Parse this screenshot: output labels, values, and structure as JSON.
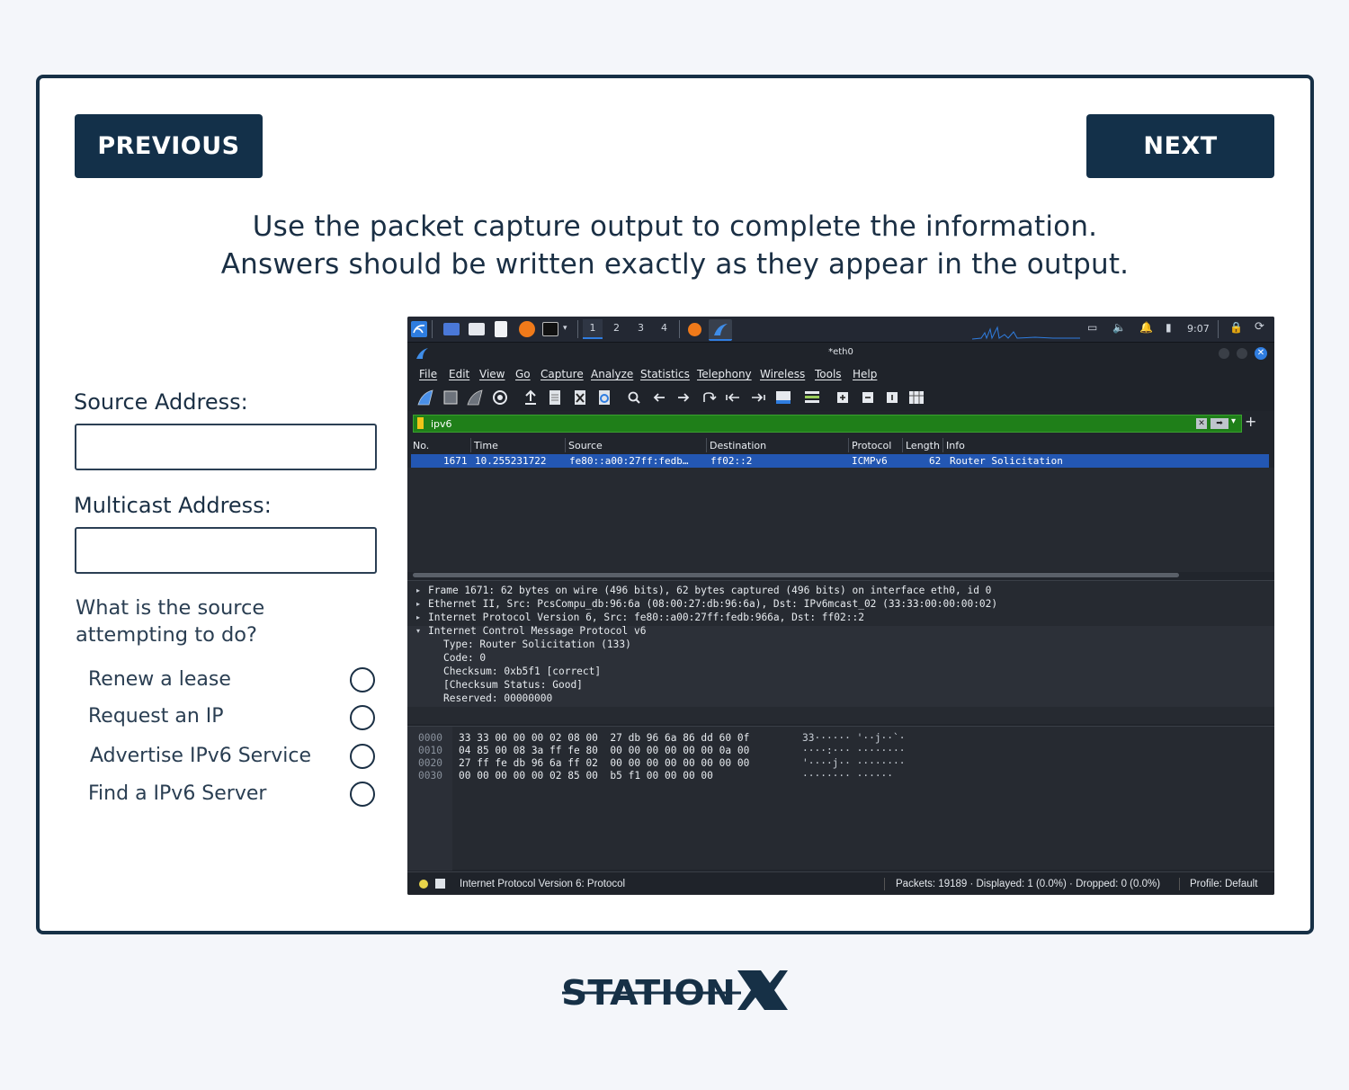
{
  "nav": {
    "previous_label": "PREVIOUS",
    "next_label": "NEXT"
  },
  "instructions": {
    "line1": "Use the packet capture output to complete the information.",
    "line2": "Answers should be written exactly as they appear in the output."
  },
  "form": {
    "source_label": "Source Address:",
    "source_value": "",
    "multicast_label": "Multicast Address:",
    "multicast_value": "",
    "question": "What is the source attempting to do?",
    "options": [
      "Renew a lease",
      "Request an IP",
      "Advertise IPv6 Service",
      "Find a IPv6 Server"
    ]
  },
  "wireshark": {
    "taskbar": {
      "workspaces": [
        "1",
        "2",
        "3",
        "4"
      ],
      "clock": "9:07"
    },
    "window_title": "*eth0",
    "menu": [
      "File",
      "Edit",
      "View",
      "Go",
      "Capture",
      "Analyze",
      "Statistics",
      "Telephony",
      "Wireless",
      "Tools",
      "Help"
    ],
    "filter": "ipv6",
    "columns": [
      "No.",
      "Time",
      "Source",
      "Destination",
      "Protocol",
      "Length",
      "Info"
    ],
    "packets": [
      {
        "no": "1671",
        "time": "10.255231722",
        "source": "fe80::a00:27ff:fedb…",
        "destination": "ff02::2",
        "protocol": "ICMPv6",
        "length": "62",
        "info": "Router Solicitation"
      }
    ],
    "details": [
      "Frame 1671: 62 bytes on wire (496 bits), 62 bytes captured (496 bits) on interface eth0, id 0",
      "Ethernet II, Src: PcsCompu_db:96:6a (08:00:27:db:96:6a), Dst: IPv6mcast_02 (33:33:00:00:00:02)",
      "Internet Protocol Version 6, Src: fe80::a00:27ff:fedb:966a, Dst: ff02::2",
      "Internet Control Message Protocol v6"
    ],
    "icmp_fields": [
      "Type: Router Solicitation (133)",
      "Code: 0",
      "Checksum: 0xb5f1 [correct]",
      "[Checksum Status: Good]",
      "Reserved: 00000000"
    ],
    "hex": [
      {
        "offset": "0000",
        "bytes": "33 33 00 00 00 02 08 00  27 db 96 6a 86 dd 60 0f",
        "ascii": "33······ '··j··`·"
      },
      {
        "offset": "0010",
        "bytes": "04 85 00 08 3a ff fe 80  00 00 00 00 00 00 0a 00",
        "ascii": "····:··· ········"
      },
      {
        "offset": "0020",
        "bytes": "27 ff fe db 96 6a ff 02  00 00 00 00 00 00 00 00",
        "ascii": "'····j·· ········"
      },
      {
        "offset": "0030",
        "bytes": "00 00 00 00 00 02 85 00  b5 f1 00 00 00 00",
        "ascii": "········ ······"
      }
    ],
    "status": {
      "field": "Internet Protocol Version 6: Protocol",
      "packets": "Packets: 19189 · Displayed: 1 (0.0%) · Dropped: 0 (0.0%)",
      "profile": "Profile: Default"
    }
  },
  "brand": {
    "logo_text": "STATIONX",
    "color": "#163046"
  },
  "colors": {
    "primary": "#133049",
    "selected_row": "#2357b3",
    "filter_ok": "#1f7f19"
  }
}
